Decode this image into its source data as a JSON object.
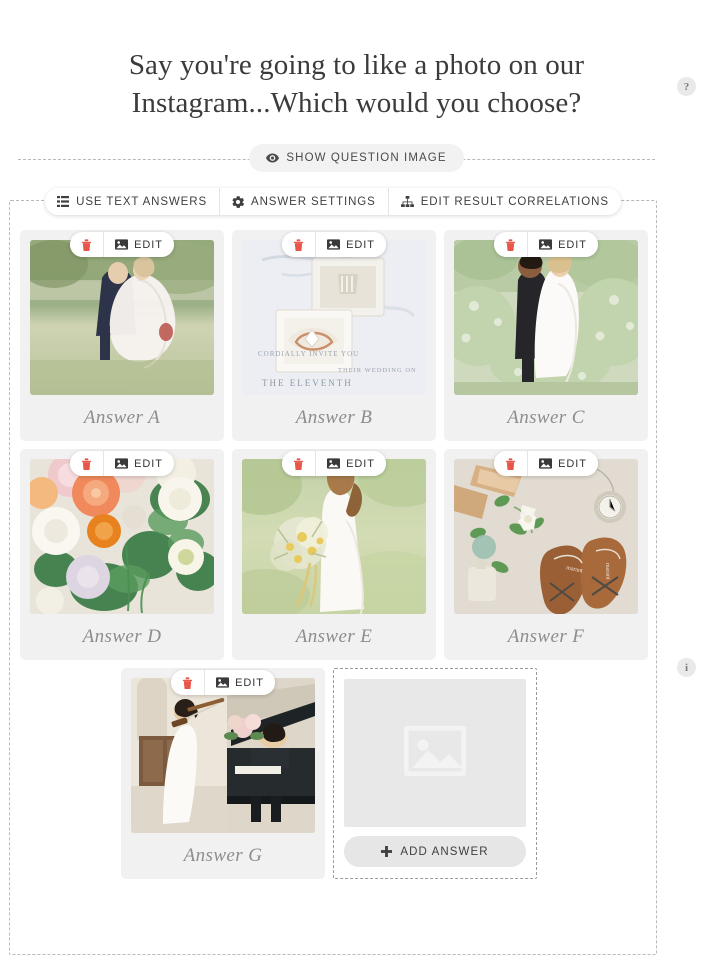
{
  "question": {
    "title": "Say you're going to like a photo on our Instagram...Which would you choose?",
    "show_image_button": {
      "label": "SHOW QUESTION IMAGE",
      "icon": "eye-icon"
    }
  },
  "toolbar": {
    "buttons": [
      {
        "label": "USE TEXT ANSWERS",
        "icon": "list-icon"
      },
      {
        "label": "ANSWER SETTINGS",
        "icon": "gear-icon"
      },
      {
        "label": "EDIT RESULT CORRELATIONS",
        "icon": "sitemap-icon"
      }
    ]
  },
  "card_actions": {
    "delete_icon": "trash-icon",
    "edit_icon": "image-icon",
    "edit_label": "EDIT"
  },
  "answers": [
    {
      "label": "Answer A",
      "image_alt": "bride-and-groom-in-vineyard"
    },
    {
      "label": "Answer B",
      "image_alt": "wedding-rings-in-boxes-on-invitation"
    },
    {
      "label": "Answer C",
      "image_alt": "couple-embracing-in-garden"
    },
    {
      "label": "Answer D",
      "image_alt": "pastel-flower-bouquet-closeup"
    },
    {
      "label": "Answer E",
      "image_alt": "bride-holding-wildflower-bouquet"
    },
    {
      "label": "Answer F",
      "image_alt": "flatlay-shoes-watch-perfume"
    },
    {
      "label": "Answer G",
      "image_alt": "violinist-and-pianist-performing"
    }
  ],
  "add_answer": {
    "label": "ADD ANSWER",
    "icon": "plus-icon",
    "placeholder_icon": "image-placeholder-icon"
  },
  "side_buttons": {
    "help": {
      "label": "?",
      "name": "help-icon"
    },
    "info": {
      "label": "i",
      "name": "info-icon"
    }
  },
  "colors": {
    "card_background": "#f1f1f1",
    "delete_icon": "#e8564a",
    "label_text": "#8d8d8d",
    "dashed_border": "#b9b9b9"
  }
}
